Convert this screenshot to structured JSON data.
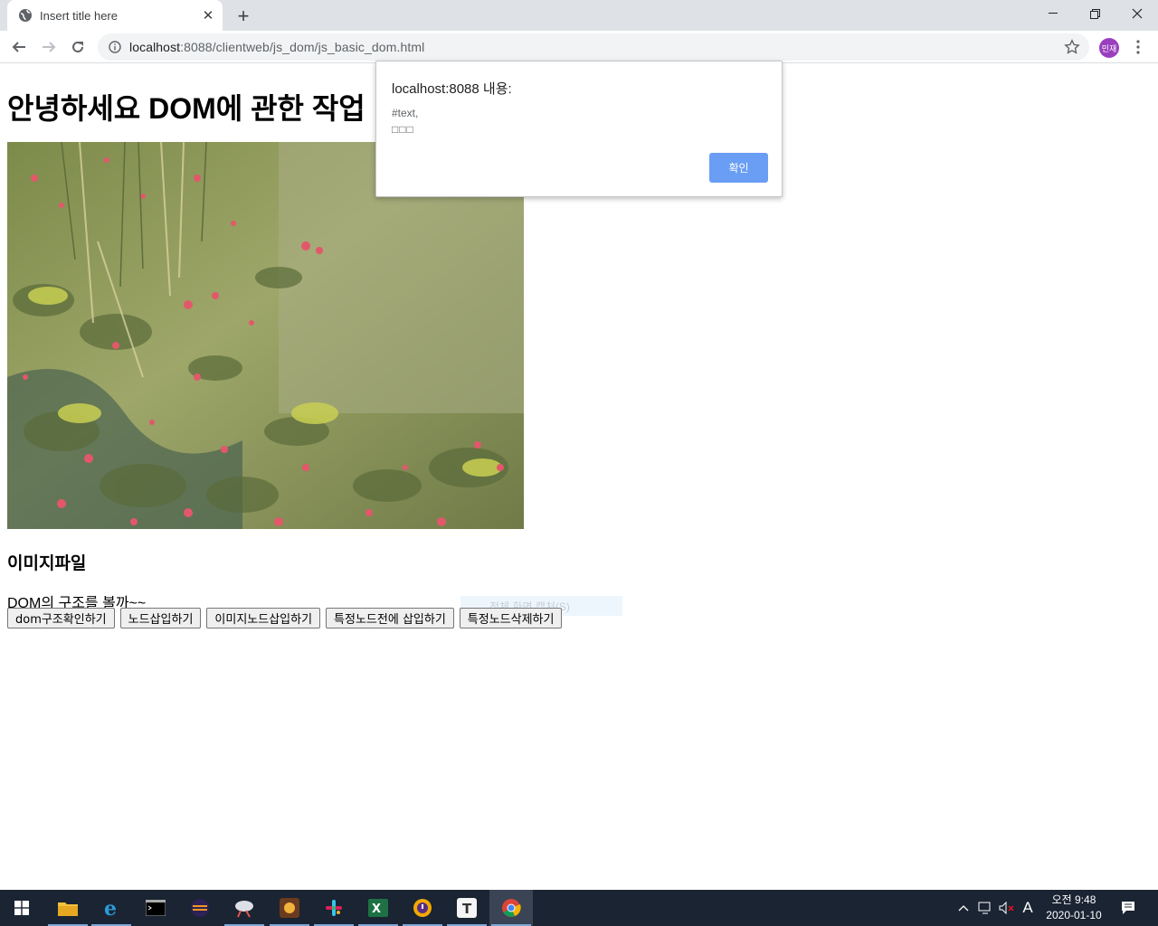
{
  "browser": {
    "tab_title": "Insert title here",
    "url_host": "localhost",
    "url_path": ":8088/clientweb/js_dom/js_basic_dom.html",
    "profile_initials": "민재"
  },
  "page": {
    "heading": "안녕하세요 DOM에 관한 작업",
    "image_caption": "이미지파일",
    "paragraph": "DOM의 구조를 볼까~~",
    "buttons": [
      "dom구조확인하기",
      "노드삽입하기",
      "이미지노드삽입하기",
      "특정노드전에 삽입하기",
      "특정노드삭제하기"
    ],
    "ghost_text": "전체 화면 캡처(S)"
  },
  "dialog": {
    "title": "localhost:8088 내용:",
    "message_line1": "#text,",
    "message_line2": "□□□",
    "ok_label": "확인"
  },
  "taskbar": {
    "apps": [
      "file-explorer-icon",
      "internet-explorer-icon",
      "terminal-icon",
      "eclipse-icon",
      "sourcetree-icon",
      "game-icon",
      "slack-icon",
      "excel-icon",
      "vpn-icon",
      "typora-icon",
      "chrome-icon"
    ],
    "ime_indicator": "A",
    "clock_time": "오전 9:48",
    "clock_date": "2020-01-10"
  },
  "colors": {
    "dialog_ok": "#6a9ef4",
    "taskbar": "#1a2433",
    "tabstrip": "#dee1e6",
    "avatar": "#9b3fbf"
  }
}
